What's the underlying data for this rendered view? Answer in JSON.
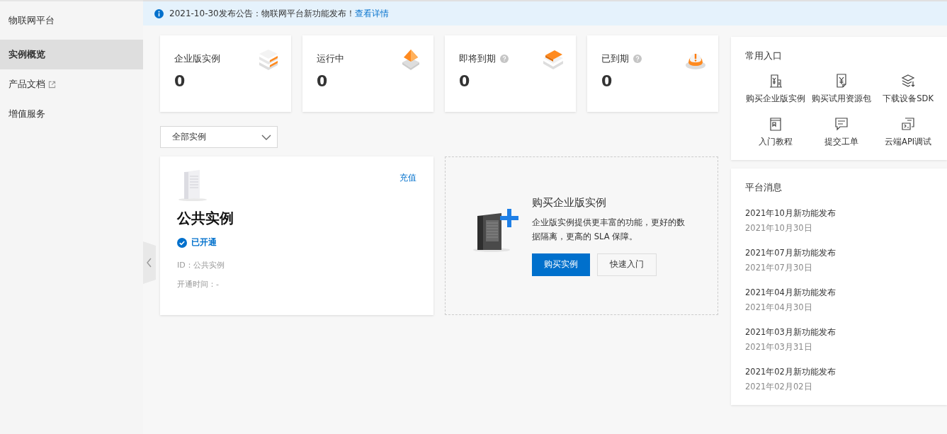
{
  "sidebar": {
    "title": "物联网平台",
    "items": [
      {
        "label": "实例概览",
        "selected": true,
        "external": false
      },
      {
        "label": "产品文档",
        "selected": false,
        "external": true
      },
      {
        "label": "增值服务",
        "selected": false,
        "external": false
      }
    ]
  },
  "notice": {
    "text": "2021-10-30发布公告：物联网平台新功能发布！",
    "link": "查看详情"
  },
  "stats": [
    {
      "label": "企业版实例",
      "value": "0",
      "help": false,
      "kind": "stack"
    },
    {
      "label": "运行中",
      "value": "0",
      "help": false,
      "kind": "pyramid"
    },
    {
      "label": "即将到期",
      "value": "0",
      "help": true,
      "kind": "papers"
    },
    {
      "label": "已到期",
      "value": "0",
      "help": true,
      "kind": "alarm"
    }
  ],
  "filter": {
    "value": "全部实例"
  },
  "instance": {
    "title": "公共实例",
    "action": "充值",
    "status": "已开通",
    "id": "ID：公共实例",
    "opened": "开通时间：-"
  },
  "promo": {
    "title": "购买企业版实例",
    "desc": "企业版实例提供更丰富的功能，更好的数据隔离，更高的 SLA 保障。",
    "primary": "购买实例",
    "secondary": "快速入门"
  },
  "shortcuts": {
    "title": "常用入口",
    "items": [
      {
        "label": "购买企业版实例",
        "kind": "building"
      },
      {
        "label": "购买试用资源包",
        "kind": "receipt"
      },
      {
        "label": "下载设备SDK",
        "kind": "layers"
      },
      {
        "label": "入门教程",
        "kind": "book"
      },
      {
        "label": "提交工单",
        "kind": "chat"
      },
      {
        "label": "云端API调试",
        "kind": "api"
      }
    ]
  },
  "messages": {
    "title": "平台消息",
    "items": [
      {
        "title": "2021年10月新功能发布",
        "date": "2021年10月30日"
      },
      {
        "title": "2021年07月新功能发布",
        "date": "2021年07月30日"
      },
      {
        "title": "2021年04月新功能发布",
        "date": "2021年04月30日"
      },
      {
        "title": "2021年03月新功能发布",
        "date": "2021年03月31日"
      },
      {
        "title": "2021年02月新功能发布",
        "date": "2021年02月02日"
      }
    ]
  }
}
